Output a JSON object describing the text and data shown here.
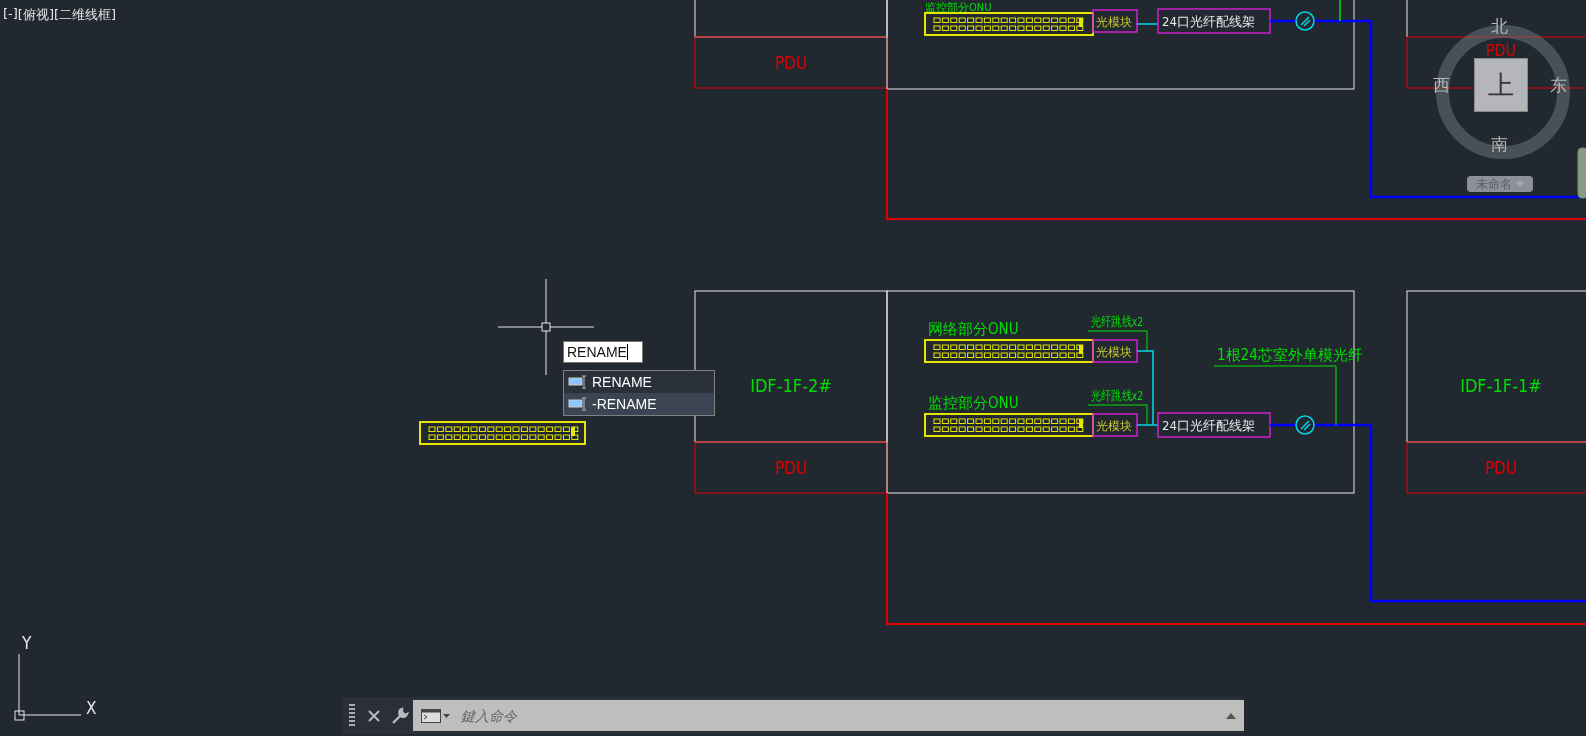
{
  "viewport_controls": [
    "[-]",
    "[俯视]",
    "[二维线框]"
  ],
  "top_section": {
    "pdu": "PDU",
    "onu_label": "监控部分ONU",
    "module": "光模块",
    "patch_panel": "24口光纤配线架",
    "right_pdu": "PDU"
  },
  "middle_section": {
    "left_rack": {
      "name": "IDF-1F-2#",
      "pdu": "PDU"
    },
    "onus": [
      {
        "label": "网络部分ONU",
        "module": "光模块",
        "jumper": "光纤跳线x2"
      },
      {
        "label": "监控部分ONU",
        "module": "光模块",
        "jumper": "光纤跳线x2"
      }
    ],
    "patch_panel": "24口光纤配线架",
    "fiber_label": "1根24芯室外单模光纤",
    "right_rack": {
      "name": "IDF-1F-1#",
      "pdu": "PDU"
    }
  },
  "command_input": {
    "value": "RENAME"
  },
  "autocomplete": [
    {
      "label": "RENAME",
      "selected": false
    },
    {
      "label": "-RENAME",
      "selected": true
    }
  ],
  "view_cube": {
    "north": "北",
    "south": "南",
    "west": "西",
    "east": "东",
    "face": "上",
    "ucs_menu": "未命名"
  },
  "ucs_icon": {
    "x_label": "X",
    "y_label": "Y"
  },
  "command_line": {
    "placeholder": "鍵入命令"
  }
}
